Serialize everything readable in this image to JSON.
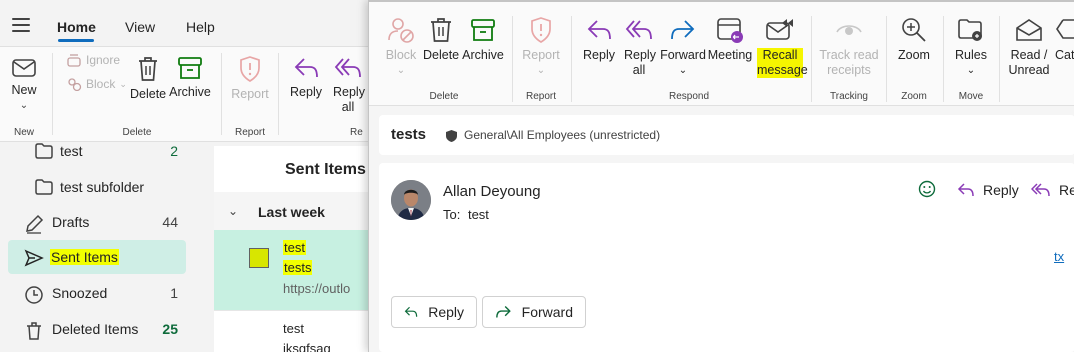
{
  "menu": {
    "home": "Home",
    "view": "View",
    "help": "Help"
  },
  "back_ribbon": {
    "new": "New",
    "new_group": "New",
    "ignore": "Ignore",
    "block": "Block",
    "delete": "Delete",
    "archive": "Archive",
    "delete_group": "Delete",
    "report": "Report",
    "report_group": "Report",
    "reply": "Reply",
    "reply_all": "Reply all",
    "respond_group_partial": "Re"
  },
  "folders": [
    {
      "label": "test",
      "count": "2"
    },
    {
      "label": "test subfolder",
      "count": ""
    },
    {
      "label": "Drafts",
      "count": "44"
    },
    {
      "label": "Sent Items",
      "count": ""
    },
    {
      "label": "Snoozed",
      "count": "1"
    },
    {
      "label": "Deleted Items",
      "count": "25"
    }
  ],
  "message_list": {
    "title": "Sent Items",
    "group": "Last week",
    "items": [
      {
        "line1": "test",
        "line2": "tests",
        "line3": "https://outlo"
      },
      {
        "line1": "test",
        "line2": "jksgfsag"
      }
    ]
  },
  "ribbon": {
    "block": "Block",
    "delete": "Delete",
    "archive": "Archive",
    "delete_group": "Delete",
    "report": "Report",
    "report_group": "Report",
    "reply": "Reply",
    "reply_all": "Reply all",
    "forward": "Forward",
    "meeting": "Meeting",
    "recall_line1": "Recall",
    "recall_line2": "message",
    "respond_group": "Respond",
    "track_line1": "Track read",
    "track_line2": "receipts",
    "tracking_group": "Tracking",
    "zoom": "Zoom",
    "zoom_group": "Zoom",
    "rules": "Rules",
    "move_group": "Move",
    "read_unread_line1": "Read /",
    "read_unread_line2": "Unread",
    "categorize_partial": "Cate"
  },
  "reading": {
    "subject": "tests",
    "sensitivity": "General\\All Employees (unrestricted)",
    "sender": "Allan Deyoung",
    "to_label": "To:",
    "to_value": "test",
    "reply": "Reply",
    "reply_all_partial": "Rep",
    "body_link": "tx",
    "reply_button": "Reply",
    "forward_button": "Forward"
  },
  "colors": {
    "accent": "#0f6cbd",
    "highlight": "#f2ff00",
    "selected": "#cfeee6",
    "purple": "#8a3bb6"
  }
}
